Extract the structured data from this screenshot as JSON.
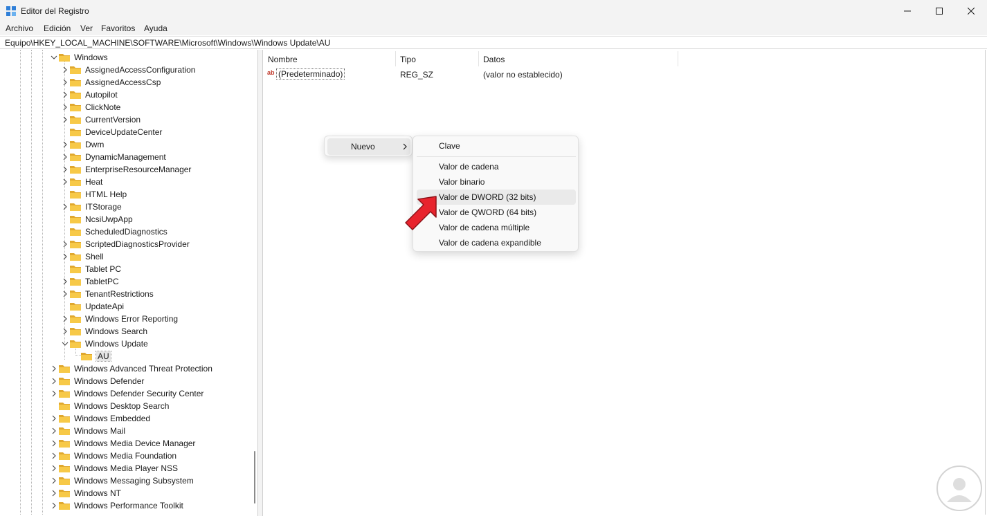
{
  "window": {
    "title": "Editor del Registro",
    "app_icon": "registry-editor-icon",
    "controls": [
      "minimize-icon",
      "maximize-icon",
      "close-icon"
    ]
  },
  "menubar": {
    "items": [
      "Archivo",
      "Edición",
      "Ver",
      "Favoritos",
      "Ayuda"
    ]
  },
  "address": {
    "path": "Equipo\\HKEY_LOCAL_MACHINE\\SOFTWARE\\Microsoft\\Windows\\Windows Update\\AU"
  },
  "tree": {
    "nodes": [
      {
        "label": "Windows",
        "depth": 0,
        "state": "expanded"
      },
      {
        "label": "AssignedAccessConfiguration",
        "depth": 1,
        "state": "collapsed"
      },
      {
        "label": "AssignedAccessCsp",
        "depth": 1,
        "state": "collapsed"
      },
      {
        "label": "Autopilot",
        "depth": 1,
        "state": "collapsed"
      },
      {
        "label": "ClickNote",
        "depth": 1,
        "state": "collapsed"
      },
      {
        "label": "CurrentVersion",
        "depth": 1,
        "state": "collapsed"
      },
      {
        "label": "DeviceUpdateCenter",
        "depth": 1,
        "state": "leaf"
      },
      {
        "label": "Dwm",
        "depth": 1,
        "state": "collapsed"
      },
      {
        "label": "DynamicManagement",
        "depth": 1,
        "state": "collapsed"
      },
      {
        "label": "EnterpriseResourceManager",
        "depth": 1,
        "state": "collapsed"
      },
      {
        "label": "Heat",
        "depth": 1,
        "state": "collapsed"
      },
      {
        "label": "HTML Help",
        "depth": 1,
        "state": "leaf"
      },
      {
        "label": "ITStorage",
        "depth": 1,
        "state": "collapsed"
      },
      {
        "label": "NcsiUwpApp",
        "depth": 1,
        "state": "leaf"
      },
      {
        "label": "ScheduledDiagnostics",
        "depth": 1,
        "state": "leaf"
      },
      {
        "label": "ScriptedDiagnosticsProvider",
        "depth": 1,
        "state": "collapsed"
      },
      {
        "label": "Shell",
        "depth": 1,
        "state": "collapsed"
      },
      {
        "label": "Tablet PC",
        "depth": 1,
        "state": "leaf"
      },
      {
        "label": "TabletPC",
        "depth": 1,
        "state": "collapsed"
      },
      {
        "label": "TenantRestrictions",
        "depth": 1,
        "state": "collapsed"
      },
      {
        "label": "UpdateApi",
        "depth": 1,
        "state": "leaf"
      },
      {
        "label": "Windows Error Reporting",
        "depth": 1,
        "state": "collapsed"
      },
      {
        "label": "Windows Search",
        "depth": 1,
        "state": "collapsed"
      },
      {
        "label": "Windows Update",
        "depth": 1,
        "state": "expanded"
      },
      {
        "label": "AU",
        "depth": 2,
        "state": "selected"
      },
      {
        "label": "Windows Advanced Threat Protection",
        "depth": 0,
        "state": "collapsed"
      },
      {
        "label": "Windows Defender",
        "depth": 0,
        "state": "collapsed"
      },
      {
        "label": "Windows Defender Security Center",
        "depth": 0,
        "state": "collapsed"
      },
      {
        "label": "Windows Desktop Search",
        "depth": 0,
        "state": "leaf"
      },
      {
        "label": "Windows Embedded",
        "depth": 0,
        "state": "collapsed"
      },
      {
        "label": "Windows Mail",
        "depth": 0,
        "state": "collapsed"
      },
      {
        "label": "Windows Media Device Manager",
        "depth": 0,
        "state": "collapsed"
      },
      {
        "label": "Windows Media Foundation",
        "depth": 0,
        "state": "collapsed"
      },
      {
        "label": "Windows Media Player NSS",
        "depth": 0,
        "state": "collapsed"
      },
      {
        "label": "Windows Messaging Subsystem",
        "depth": 0,
        "state": "collapsed"
      },
      {
        "label": "Windows NT",
        "depth": 0,
        "state": "collapsed"
      },
      {
        "label": "Windows Performance Toolkit",
        "depth": 0,
        "state": "collapsed"
      }
    ]
  },
  "list": {
    "columns": [
      "Nombre",
      "Tipo",
      "Datos"
    ],
    "rows": [
      {
        "icon": "string-value-icon",
        "name": "(Predeterminado)",
        "type": "REG_SZ",
        "data": "(valor no establecido)"
      }
    ]
  },
  "context_menu": {
    "item": "Nuevo",
    "submenu_arrow": "chevron-right-icon"
  },
  "submenu": {
    "items": [
      "Clave",
      "Valor de cadena",
      "Valor binario",
      "Valor de DWORD (32 bits)",
      "Valor de QWORD (64 bits)",
      "Valor de cadena múltiple",
      "Valor de cadena expandible"
    ],
    "highlighted": "Valor de DWORD (32 bits)"
  },
  "annotation": {
    "pointer": "red-arrow-icon",
    "color": "#e8232d"
  },
  "colors": {
    "folder": "#f7c948",
    "folder_dark": "#e0a82e",
    "titlebar": "#f3f3f3"
  }
}
